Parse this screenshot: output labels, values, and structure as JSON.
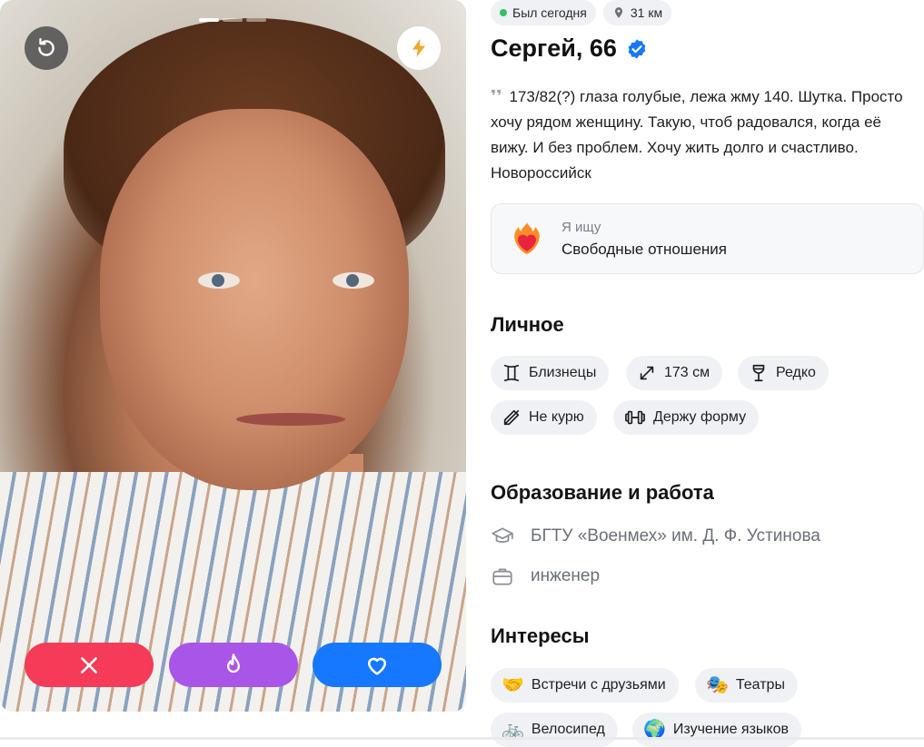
{
  "photo": {
    "page_count": 3,
    "active_page": 1
  },
  "status": {
    "last_seen": "Был сегодня",
    "distance": "31 км"
  },
  "profile": {
    "name_age": "Сергей, 66",
    "verified": true,
    "bio": "173/82(?) глаза голубые, лежа жму 140. Шутка. Просто хочу рядом женщину. Такую, чтоб радовался, когда её вижу. И без проблем. Хочу жить долго и счастливо. Новороссийск"
  },
  "looking_for": {
    "label": "Я ищу",
    "value": "Свободные отношения",
    "icon": "burning-heart-icon"
  },
  "personal": {
    "title": "Личное",
    "chips": [
      {
        "label": "Близнецы",
        "icon": "gemini-icon"
      },
      {
        "label": "173 см",
        "icon": "height-icon"
      },
      {
        "label": "Редко",
        "icon": "wine-glass-icon"
      },
      {
        "label": "Не курю",
        "icon": "no-smoking-icon"
      },
      {
        "label": "Держу форму",
        "icon": "dumbbell-icon"
      }
    ]
  },
  "education": {
    "title": "Образование и работа",
    "school": "БГТУ «Военмех» им. Д. Ф. Устинова",
    "job": "инженер"
  },
  "interests": {
    "title": "Интересы",
    "chips": [
      {
        "label": "Встречи с друзьями",
        "emoji": "🤝"
      },
      {
        "label": "Театры",
        "emoji": "🎭"
      },
      {
        "label": "Велосипед",
        "emoji": "🚲"
      },
      {
        "label": "Изучение языков",
        "emoji": "🌍"
      }
    ]
  },
  "colors": {
    "dislike": "#f53b57",
    "superlike": "#a855e8",
    "like": "#1677ff",
    "verified": "#1677ff",
    "online": "#30c161"
  }
}
